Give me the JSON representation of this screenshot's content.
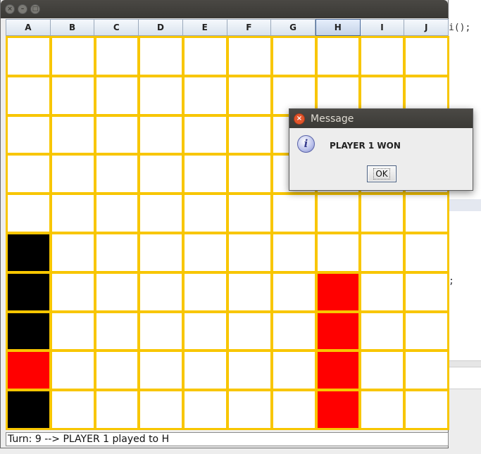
{
  "window": {
    "controls": [
      "close",
      "minimize",
      "maximize"
    ]
  },
  "columns": [
    "A",
    "B",
    "C",
    "D",
    "E",
    "F",
    "G",
    "H",
    "I",
    "J"
  ],
  "active_column": "H",
  "board": {
    "rows": 10,
    "cols": 10,
    "cells": [
      [
        "",
        "",
        "",
        "",
        "",
        "",
        "",
        "",
        "",
        ""
      ],
      [
        "",
        "",
        "",
        "",
        "",
        "",
        "",
        "",
        "",
        ""
      ],
      [
        "",
        "",
        "",
        "",
        "",
        "",
        "",
        "",
        "",
        ""
      ],
      [
        "",
        "",
        "",
        "",
        "",
        "",
        "",
        "",
        "",
        ""
      ],
      [
        "",
        "",
        "",
        "",
        "",
        "",
        "",
        "",
        "",
        ""
      ],
      [
        "black",
        "",
        "",
        "",
        "",
        "",
        "",
        "",
        "",
        ""
      ],
      [
        "black",
        "",
        "",
        "",
        "",
        "",
        "",
        "red",
        "",
        ""
      ],
      [
        "black",
        "",
        "",
        "",
        "",
        "",
        "",
        "red",
        "",
        ""
      ],
      [
        "red",
        "",
        "",
        "",
        "",
        "",
        "",
        "red",
        "",
        ""
      ],
      [
        "black",
        "",
        "",
        "",
        "",
        "",
        "",
        "red",
        "",
        ""
      ]
    ]
  },
  "colors": {
    "grid": "#f8c600",
    "player1": "#ff0000",
    "player2": "#000000"
  },
  "status": {
    "text": "Turn: 9 --> PLAYER 1 played to H"
  },
  "dialog": {
    "title": "Message",
    "message": "PLAYER 1 WON",
    "ok_label": "OK",
    "icon": "info-icon"
  },
  "background": {
    "code_line_1": "i();",
    "code_line_2": ";"
  }
}
